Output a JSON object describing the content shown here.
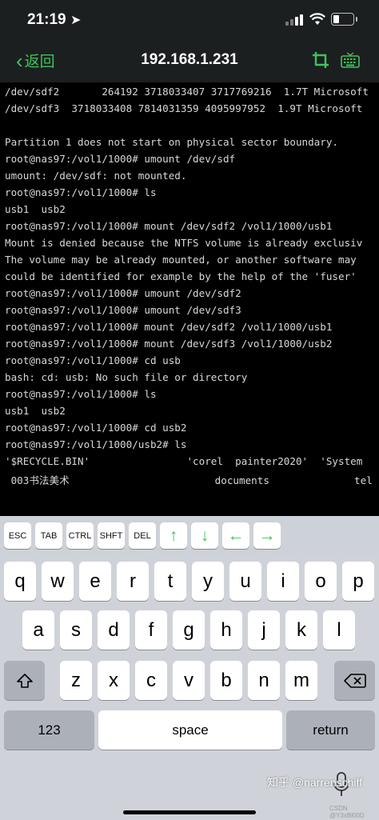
{
  "status_bar": {
    "time": "21:19"
  },
  "nav": {
    "back_label": "返回",
    "title": "192.168.1.231"
  },
  "terminal": {
    "lines": [
      "/dev/sdf2       264192 3718033407 3717769216  1.7T Microsoft",
      "/dev/sdf3  3718033408 7814031359 4095997952  1.9T Microsoft",
      "",
      "Partition 1 does not start on physical sector boundary.",
      "root@nas97:/vol1/1000# umount /dev/sdf",
      "umount: /dev/sdf: not mounted.",
      "root@nas97:/vol1/1000# ls",
      "usb1  usb2",
      "root@nas97:/vol1/1000# mount /dev/sdf2 /vol1/1000/usb1",
      "Mount is denied because the NTFS volume is already exclusiv",
      "The volume may be already mounted, or another software may",
      "could be identified for example by the help of the 'fuser'",
      "root@nas97:/vol1/1000# umount /dev/sdf2",
      "root@nas97:/vol1/1000# umount /dev/sdf3",
      "root@nas97:/vol1/1000# mount /dev/sdf2 /vol1/1000/usb1",
      "root@nas97:/vol1/1000# mount /dev/sdf3 /vol1/1000/usb2",
      "root@nas97:/vol1/1000# cd usb",
      "bash: cd: usb: No such file or directory",
      "root@nas97:/vol1/1000# ls",
      "usb1  usb2",
      "root@nas97:/vol1/1000# cd usb2",
      "root@nas97:/vol1/1000/usb2# ls",
      "'$RECYCLE.BIN'                'corel  painter2020'  'System",
      " 003书法美术                        documents              tel"
    ]
  },
  "extra_keys": [
    "ESC",
    "TAB",
    "CTRL",
    "SHFT",
    "DEL",
    "↑",
    "↓",
    "←",
    "→"
  ],
  "keyboard": {
    "row1": [
      "q",
      "w",
      "e",
      "r",
      "t",
      "y",
      "u",
      "i",
      "o",
      "p"
    ],
    "row2": [
      "a",
      "s",
      "d",
      "f",
      "g",
      "h",
      "j",
      "k",
      "l"
    ],
    "row3": [
      "z",
      "x",
      "c",
      "v",
      "b",
      "n",
      "m"
    ],
    "numbers_label": "123",
    "space_label": "space",
    "return_label": "return"
  },
  "watermark": {
    "text": "知乎 @narrenschiff",
    "sub": "CSDN @Y3xBl00D"
  },
  "colors": {
    "accent": "#3ec45a",
    "terminal_bg": "#000000",
    "terminal_text": "#d8d8d8",
    "keyboard_bg": "#cfd3d9"
  }
}
